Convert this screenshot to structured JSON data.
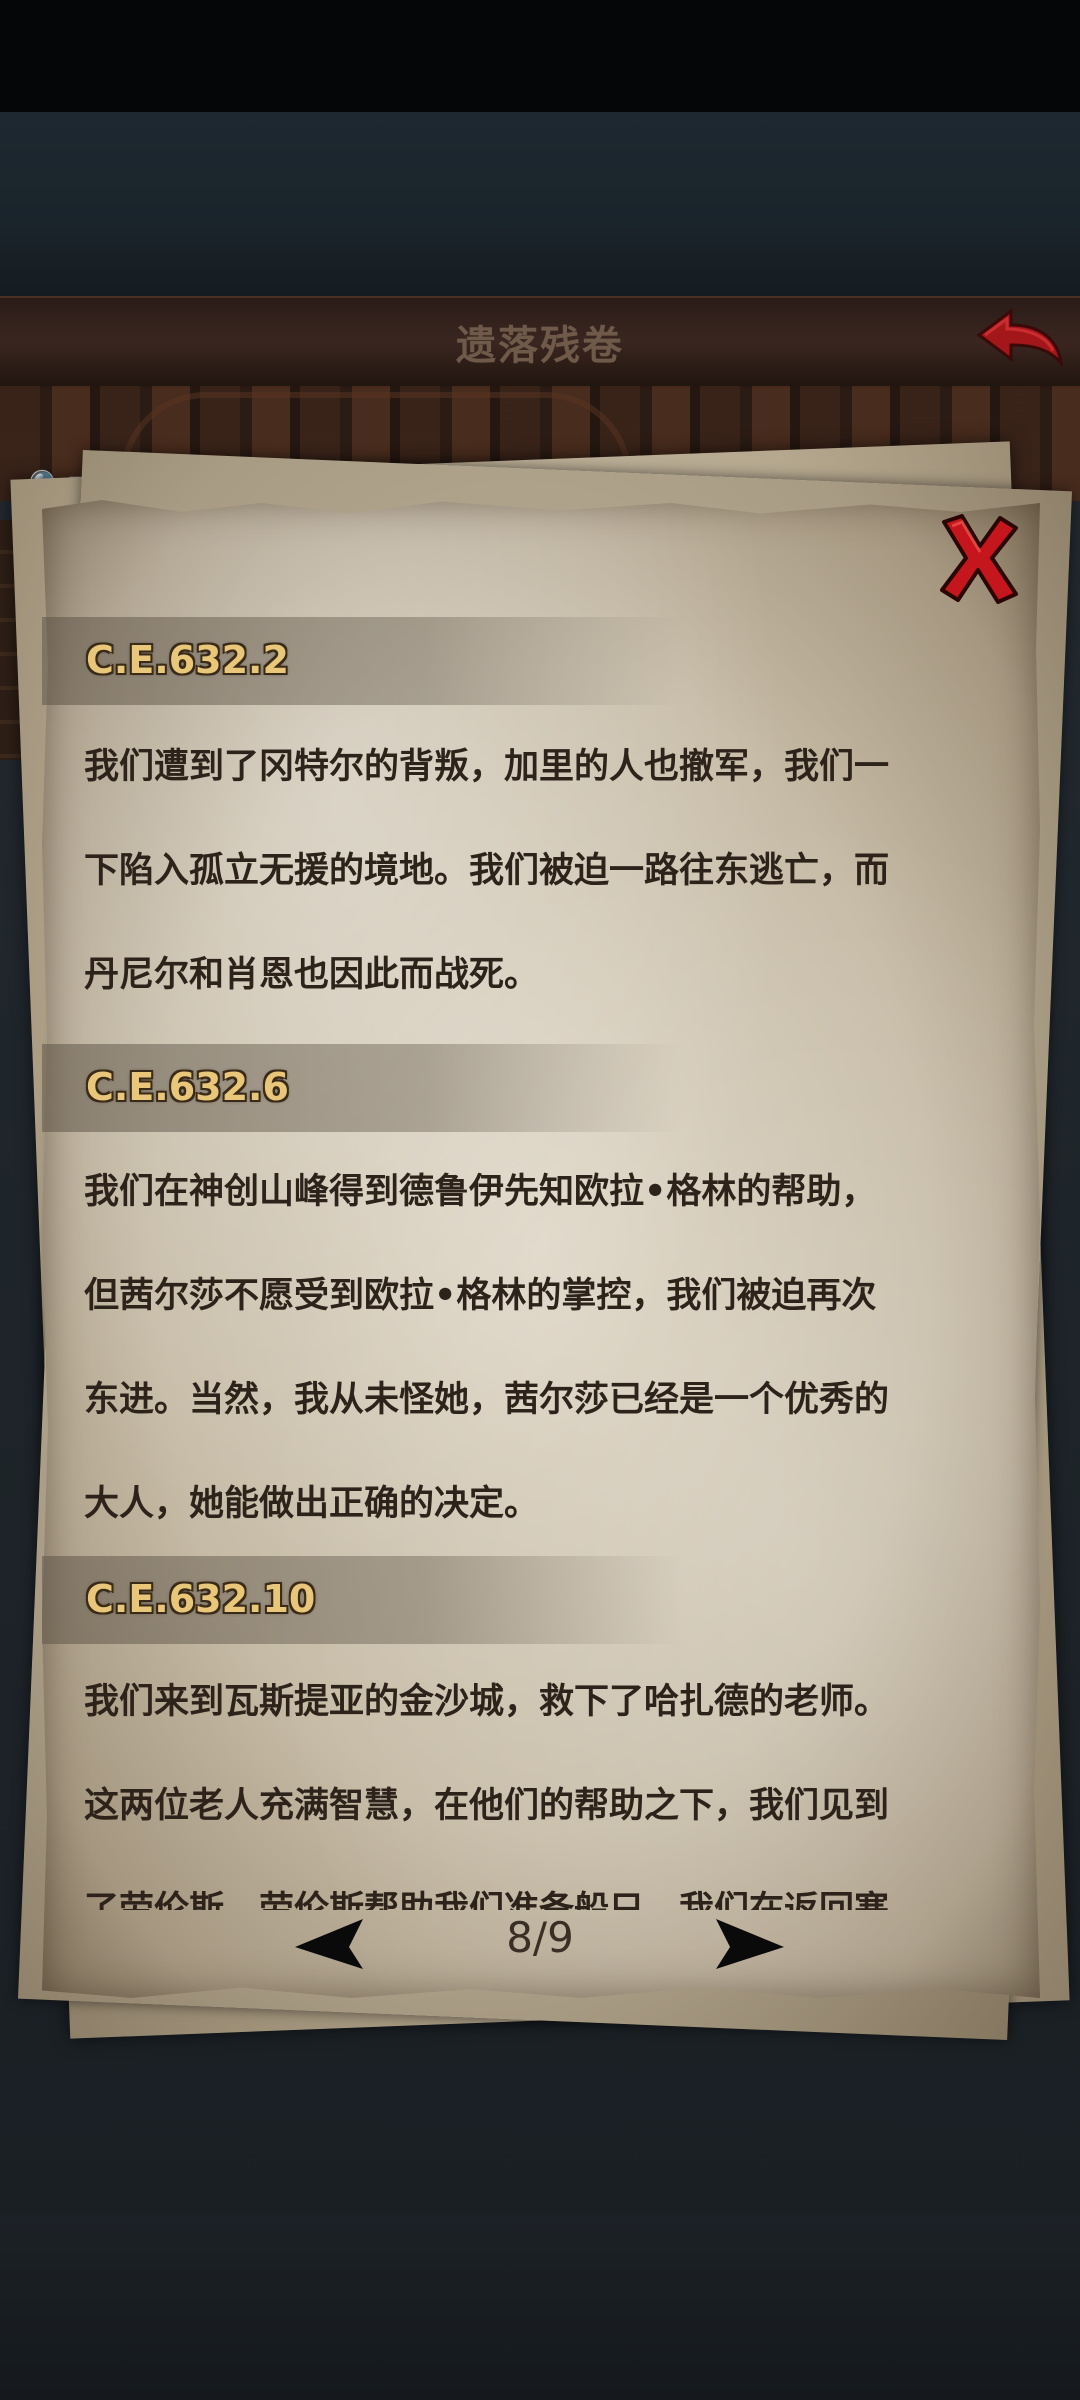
{
  "header": {
    "title": "遗落残卷",
    "back_icon": "back-arrow-icon"
  },
  "background": {
    "search_label": "🔍文"
  },
  "scroll": {
    "close_icon": "close-x-icon",
    "entries": [
      {
        "date": "C.E.632.2",
        "lines": [
          "我们遭到了冈特尔的背叛，加里的人也撤军，我们一",
          "下陷入孤立无援的境地。我们被迫一路往东逃亡，而",
          "丹尼尔和肖恩也因此而战死。"
        ]
      },
      {
        "date": "C.E.632.6",
        "lines": [
          "我们在神创山峰得到德鲁伊先知欧拉•格林的帮助，",
          "但茜尔莎不愿受到欧拉•格林的掌控，我们被迫再次",
          "东进。当然，我从未怪她，茜尔莎已经是一个优秀的",
          "大人，她能做出正确的决定。"
        ]
      },
      {
        "date": "C.E.632.10",
        "lines": [
          "我们来到瓦斯提亚的金沙城，救下了哈扎德的老师。",
          "这两位老人充满智慧，在他们的帮助之下，我们见到",
          "了劳伦斯。劳伦斯帮助我们准备船只，我们在返回塞"
        ]
      }
    ],
    "pagination": {
      "current": "8/9",
      "prev_icon": "prev-arrow-icon",
      "next_icon": "next-arrow-icon"
    }
  },
  "colors": {
    "date_gold": "#e8c67a",
    "ink": "#2d231a",
    "close_red": "#c4161c"
  }
}
